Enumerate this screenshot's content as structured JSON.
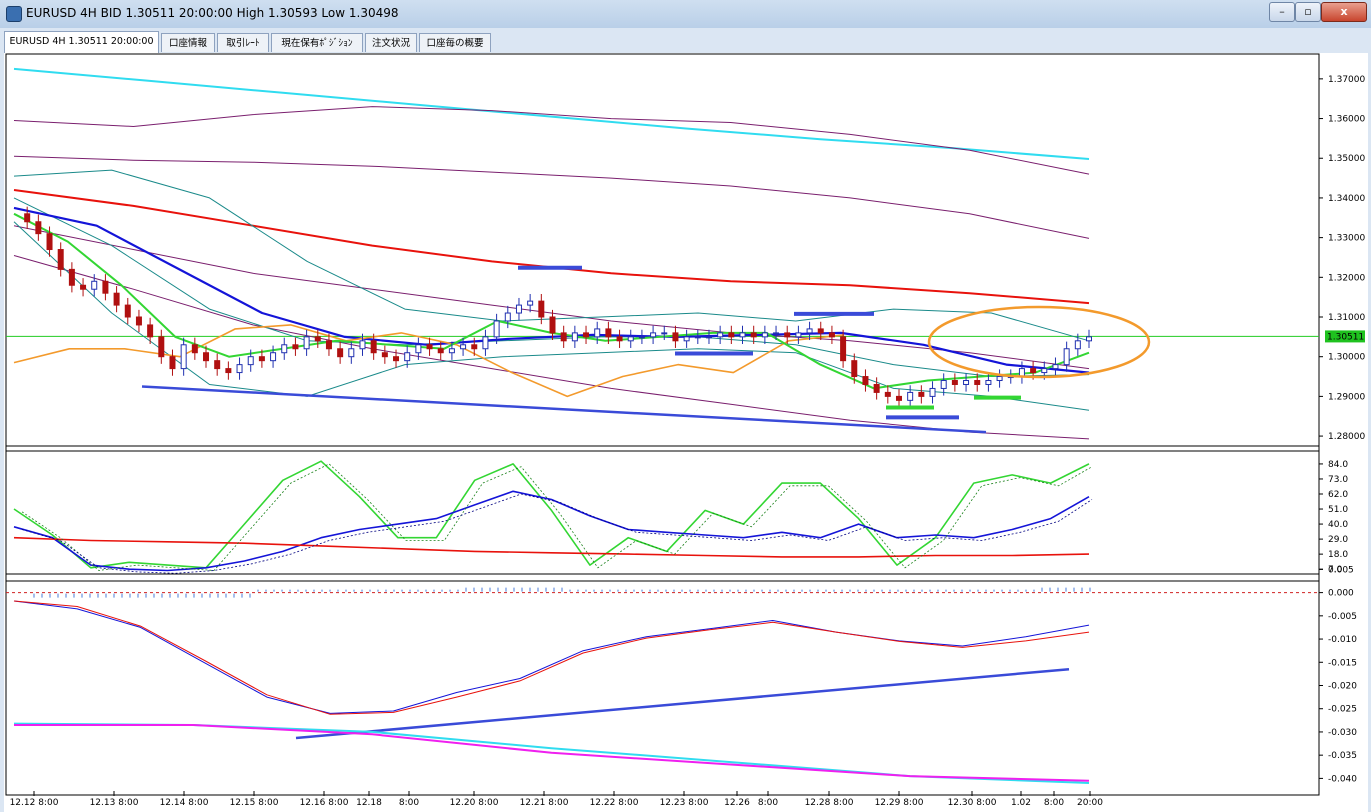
{
  "window": {
    "title": "EURUSD 4H BID 1.30511 20:00:00 High 1.30593 Low 1.30498",
    "min_icon": "minimize-icon",
    "max_icon": "restore-icon",
    "close_icon": "close-icon",
    "min_label": "–",
    "max_label": "▫",
    "close_label": "x"
  },
  "tabs": [
    {
      "label": "EURUSD 4H 1.30511 20:00:00",
      "active": true
    },
    {
      "label": "口座情報",
      "active": false
    },
    {
      "label": "取引ﾚｰﾄ",
      "active": false
    },
    {
      "label": "現在保有ﾎﾟｼﾞｼｮﾝ",
      "active": false
    },
    {
      "label": "注文状況",
      "active": false
    },
    {
      "label": "口座毎の概要",
      "active": false
    }
  ],
  "colors": {
    "cyan": "#30dcf0",
    "purple": "#7a1f6e",
    "red": "#e8120c",
    "blue": "#1414d8",
    "green": "#33d633",
    "orange": "#f39a2c",
    "teal": "#1a8a8a",
    "magenta": "#ef20ef",
    "hline": "#22cc22",
    "price_box": "#1fc21f"
  },
  "chart_data": [
    {
      "type": "line",
      "name": "price",
      "ylim": [
        1.2775,
        1.3745
      ],
      "y_ticks": [
        "1.37000",
        "1.36000",
        "1.35000",
        "1.34000",
        "1.33000",
        "1.32000",
        "1.31000",
        "1.30000",
        "1.29000",
        "1.28000"
      ],
      "y_tick_values": [
        1.37,
        1.36,
        1.35,
        1.34,
        1.33,
        1.32,
        1.31,
        1.3,
        1.29,
        1.28
      ],
      "current_price": "1.30511",
      "current_price_value": 1.30511,
      "x_labels": [
        "12.12 8:00",
        "12.13 8:00",
        "12.14 8:00",
        "12.15 8:00",
        "12.16 8:00",
        "12.18",
        "8:00",
        "12.20 8:00",
        "12.21 8:00",
        "12.22 8:00",
        "12.23 8:00",
        "12.26",
        "8:00",
        "12.28 8:00",
        "12.29 8:00",
        "12.30 8:00",
        "1.02",
        "8:00",
        "20:00"
      ],
      "closes": [
        1.336,
        1.334,
        1.331,
        1.327,
        1.322,
        1.318,
        1.317,
        1.319,
        1.316,
        1.313,
        1.31,
        1.308,
        1.305,
        1.3,
        1.297,
        1.303,
        1.301,
        1.299,
        1.297,
        1.296,
        1.298,
        1.3,
        1.299,
        1.301,
        1.303,
        1.302,
        1.305,
        1.304,
        1.302,
        1.3,
        1.302,
        1.304,
        1.301,
        1.3,
        1.299,
        1.301,
        1.303,
        1.302,
        1.301,
        1.302,
        1.303,
        1.302,
        1.305,
        1.309,
        1.311,
        1.313,
        1.314,
        1.31,
        1.306,
        1.304,
        1.306,
        1.305,
        1.307,
        1.305,
        1.304,
        1.305,
        1.305,
        1.306,
        1.306,
        1.304,
        1.305,
        1.305,
        1.305,
        1.306,
        1.305,
        1.306,
        1.305,
        1.306,
        1.306,
        1.305,
        1.306,
        1.307,
        1.306,
        1.305,
        1.299,
        1.295,
        1.293,
        1.291,
        1.29,
        1.289,
        1.291,
        1.29,
        1.292,
        1.294,
        1.293,
        1.294,
        1.293,
        1.294,
        1.295,
        1.295,
        1.297,
        1.296,
        1.297,
        1.298,
        1.302,
        1.304,
        1.305
      ],
      "series": [
        {
          "key": "cyan_trend",
          "color": "#30dcf0",
          "width": 2,
          "values": [
            1.3725,
            1.3695,
            1.3665,
            1.3635,
            1.3605,
            1.3575,
            1.3548,
            1.3525,
            1.3498
          ]
        },
        {
          "key": "purple_outer_hi",
          "color": "#7a1f6e",
          "width": 1,
          "values": [
            1.3595,
            1.358,
            1.361,
            1.363,
            1.362,
            1.36,
            1.359,
            1.356,
            1.352,
            1.346
          ]
        },
        {
          "key": "purple_mid_hi",
          "color": "#7a1f6e",
          "width": 1,
          "values": [
            1.3505,
            1.3495,
            1.349,
            1.348,
            1.3465,
            1.345,
            1.343,
            1.34,
            1.336,
            1.3298
          ]
        },
        {
          "key": "red_ma",
          "color": "#e8120c",
          "width": 2,
          "values": [
            1.342,
            1.338,
            1.333,
            1.328,
            1.324,
            1.321,
            1.319,
            1.318,
            1.316,
            1.3135
          ]
        },
        {
          "key": "purple_mid_lo",
          "color": "#7a1f6e",
          "width": 1,
          "values": [
            1.333,
            1.327,
            1.321,
            1.317,
            1.313,
            1.309,
            1.306,
            1.304,
            1.301,
            1.297
          ]
        },
        {
          "key": "purple_outer_lo",
          "color": "#7a1f6e",
          "width": 1,
          "values": [
            1.3255,
            1.317,
            1.308,
            1.302,
            1.297,
            1.292,
            1.288,
            1.284,
            1.281,
            1.2793
          ]
        },
        {
          "key": "teal_band_hi",
          "color": "#1a8a8a",
          "width": 1,
          "values": [
            1.3455,
            1.347,
            1.34,
            1.324,
            1.312,
            1.309,
            1.31,
            1.311,
            1.309,
            1.312,
            1.311,
            1.304
          ]
        },
        {
          "key": "teal_band_lo",
          "color": "#1a8a8a",
          "width": 1,
          "values": [
            1.334,
            1.311,
            1.293,
            1.29,
            1.298,
            1.3,
            1.301,
            1.302,
            1.301,
            1.292,
            1.29,
            1.2865
          ]
        },
        {
          "key": "teal_band_mid",
          "color": "#1a8a8a",
          "width": 1,
          "values": [
            1.34,
            1.328,
            1.312,
            1.304,
            1.303,
            1.304,
            1.305,
            1.305,
            1.303,
            1.298,
            1.295,
            1.2955
          ]
        },
        {
          "key": "blue_ma",
          "color": "#1414d8",
          "width": 2.2,
          "values": [
            1.3375,
            1.333,
            1.322,
            1.311,
            1.305,
            1.303,
            1.3045,
            1.3055,
            1.305,
            1.3055,
            1.306,
            1.303,
            1.298,
            1.296
          ]
        },
        {
          "key": "orange_line",
          "color": "#f39a2c",
          "width": 1.6,
          "values": [
            1.2985,
            1.302,
            1.302,
            1.3,
            1.307,
            1.308,
            1.304,
            1.306,
            1.303,
            1.296,
            1.29,
            1.295,
            1.298,
            1.296,
            1.304,
            1.3055
          ]
        },
        {
          "key": "green_ma",
          "color": "#33d633",
          "width": 2,
          "values": [
            1.336,
            1.329,
            1.318,
            1.305,
            1.3,
            1.302,
            1.304,
            1.303,
            1.302,
            1.309,
            1.306,
            1.304,
            1.305,
            1.306,
            1.306,
            1.298,
            1.292,
            1.294,
            1.295,
            1.296,
            1.301
          ]
        },
        {
          "key": "blue_trend_lo",
          "color": "#3a4bd8",
          "width": 2.5,
          "values": [
            1.2925,
            1.281
          ]
        }
      ]
    },
    {
      "type": "line",
      "name": "oscillator",
      "ylim": [
        2,
        92
      ],
      "y_ticks": [
        "84.0",
        "73.0",
        "62.0",
        "51.0",
        "40.0",
        "29.0",
        "18.0",
        "7.0"
      ],
      "y_tick_values": [
        84,
        73,
        62,
        51,
        40,
        29,
        18,
        7
      ],
      "series": [
        {
          "key": "green_osc",
          "color": "#33d633",
          "width": 1.6,
          "values": [
            51,
            32,
            8,
            12,
            10,
            8,
            40,
            72,
            86,
            60,
            30,
            30,
            72,
            84,
            50,
            10,
            30,
            20,
            50,
            40,
            70,
            70,
            44,
            10,
            30,
            70,
            76,
            70,
            84
          ]
        },
        {
          "key": "blue_osc",
          "color": "#1414d8",
          "width": 1.6,
          "values": [
            38,
            30,
            10,
            7,
            6,
            8,
            13,
            20,
            30,
            36,
            40,
            44,
            54,
            64,
            58,
            46,
            36,
            34,
            32,
            30,
            34,
            30,
            40,
            30,
            32,
            30,
            36,
            44,
            60
          ]
        },
        {
          "key": "red_osc",
          "color": "#e8120c",
          "width": 1.6,
          "values": [
            30,
            28,
            27,
            26,
            24,
            22,
            20,
            19,
            18,
            17,
            16,
            16,
            17,
            17,
            18
          ]
        }
      ]
    },
    {
      "type": "line",
      "name": "macd",
      "ylim": [
        -0.0425,
        0.0025
      ],
      "y_ticks": [
        "0.005",
        "0.000",
        "-0.005",
        "-0.010",
        "-0.015",
        "-0.020",
        "-0.025",
        "-0.030",
        "-0.035",
        "-0.040"
      ],
      "y_tick_values": [
        0.005,
        0,
        -0.005,
        -0.01,
        -0.015,
        -0.02,
        -0.025,
        -0.03,
        -0.035,
        -0.04
      ],
      "series": [
        {
          "key": "macd_blue",
          "color": "#1414d8",
          "width": 1,
          "values": [
            -0.0018,
            -0.0035,
            -0.0075,
            -0.015,
            -0.0225,
            -0.026,
            -0.0255,
            -0.0215,
            -0.0185,
            -0.0125,
            -0.0095,
            -0.0078,
            -0.006,
            -0.0085,
            -0.0104,
            -0.0115,
            -0.0095,
            -0.007
          ]
        },
        {
          "key": "macd_red",
          "color": "#e8120c",
          "width": 1,
          "values": [
            -0.0018,
            -0.003,
            -0.0072,
            -0.0145,
            -0.022,
            -0.0262,
            -0.0258,
            -0.0225,
            -0.019,
            -0.013,
            -0.0098,
            -0.008,
            -0.0064,
            -0.0085,
            -0.0105,
            -0.0118,
            -0.0104,
            -0.0085
          ]
        },
        {
          "key": "macd_blue_trend",
          "color": "#3a4bd8",
          "width": 2.5,
          "values": [
            -0.0313,
            -0.0165
          ]
        },
        {
          "key": "macd_cyan",
          "color": "#30dcf0",
          "width": 2,
          "values": [
            -0.0282,
            -0.0285,
            -0.03,
            -0.0335,
            -0.0365,
            -0.0395,
            -0.041
          ]
        },
        {
          "key": "macd_magenta",
          "color": "#ef20ef",
          "width": 2,
          "values": [
            -0.0285,
            -0.0285,
            -0.0305,
            -0.0345,
            -0.037,
            -0.0395,
            -0.0405
          ]
        }
      ]
    }
  ]
}
